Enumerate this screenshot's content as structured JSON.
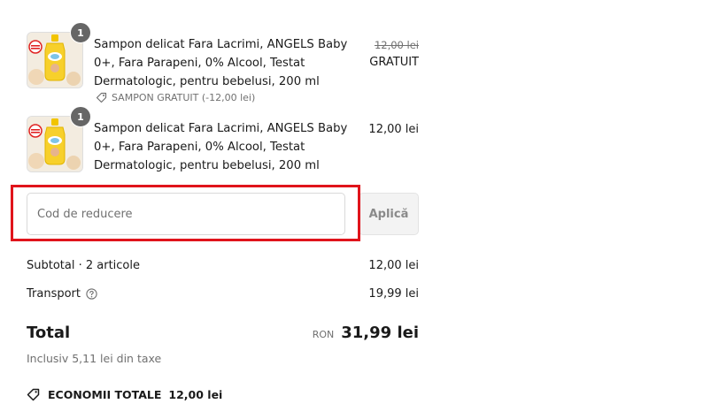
{
  "line_items": [
    {
      "quantity": "1",
      "title": "Sampon delicat Fara Lacrimi, ANGELS Baby 0+, Fara Parapeni, 0% Alcool, Testat Dermatologic, pentru bebelusi, 200 ml",
      "original_price": "12,00 lei",
      "price": "GRATUIT",
      "discount_label": "SAMPON GRATUIT (-12,00 lei)",
      "thumbnail_icon": "shampoo-bottle-icon"
    },
    {
      "quantity": "1",
      "title": "Sampon delicat Fara Lacrimi, ANGELS Baby 0+, Fara Parapeni, 0% Alcool, Testat Dermatologic, pentru bebelusi, 200 ml",
      "price": "12,00 lei",
      "thumbnail_icon": "shampoo-bottle-icon"
    }
  ],
  "discount_code": {
    "placeholder": "Cod de reducere",
    "value": "",
    "apply_label": "Aplică"
  },
  "summary": {
    "subtotal_label": "Subtotal · 2 articole",
    "subtotal_value": "12,00 lei",
    "shipping_label": "Transport",
    "shipping_value": "19,99 lei",
    "total_label": "Total",
    "total_currency": "RON",
    "total_value": "31,99 lei",
    "tax_note": "Inclusiv 5,11 lei din taxe",
    "savings_label": "ECONOMII TOTALE",
    "savings_value": "12,00 lei"
  },
  "colors": {
    "highlight": "#e0141b",
    "muted_text": "#707070",
    "badge": "#666666"
  }
}
